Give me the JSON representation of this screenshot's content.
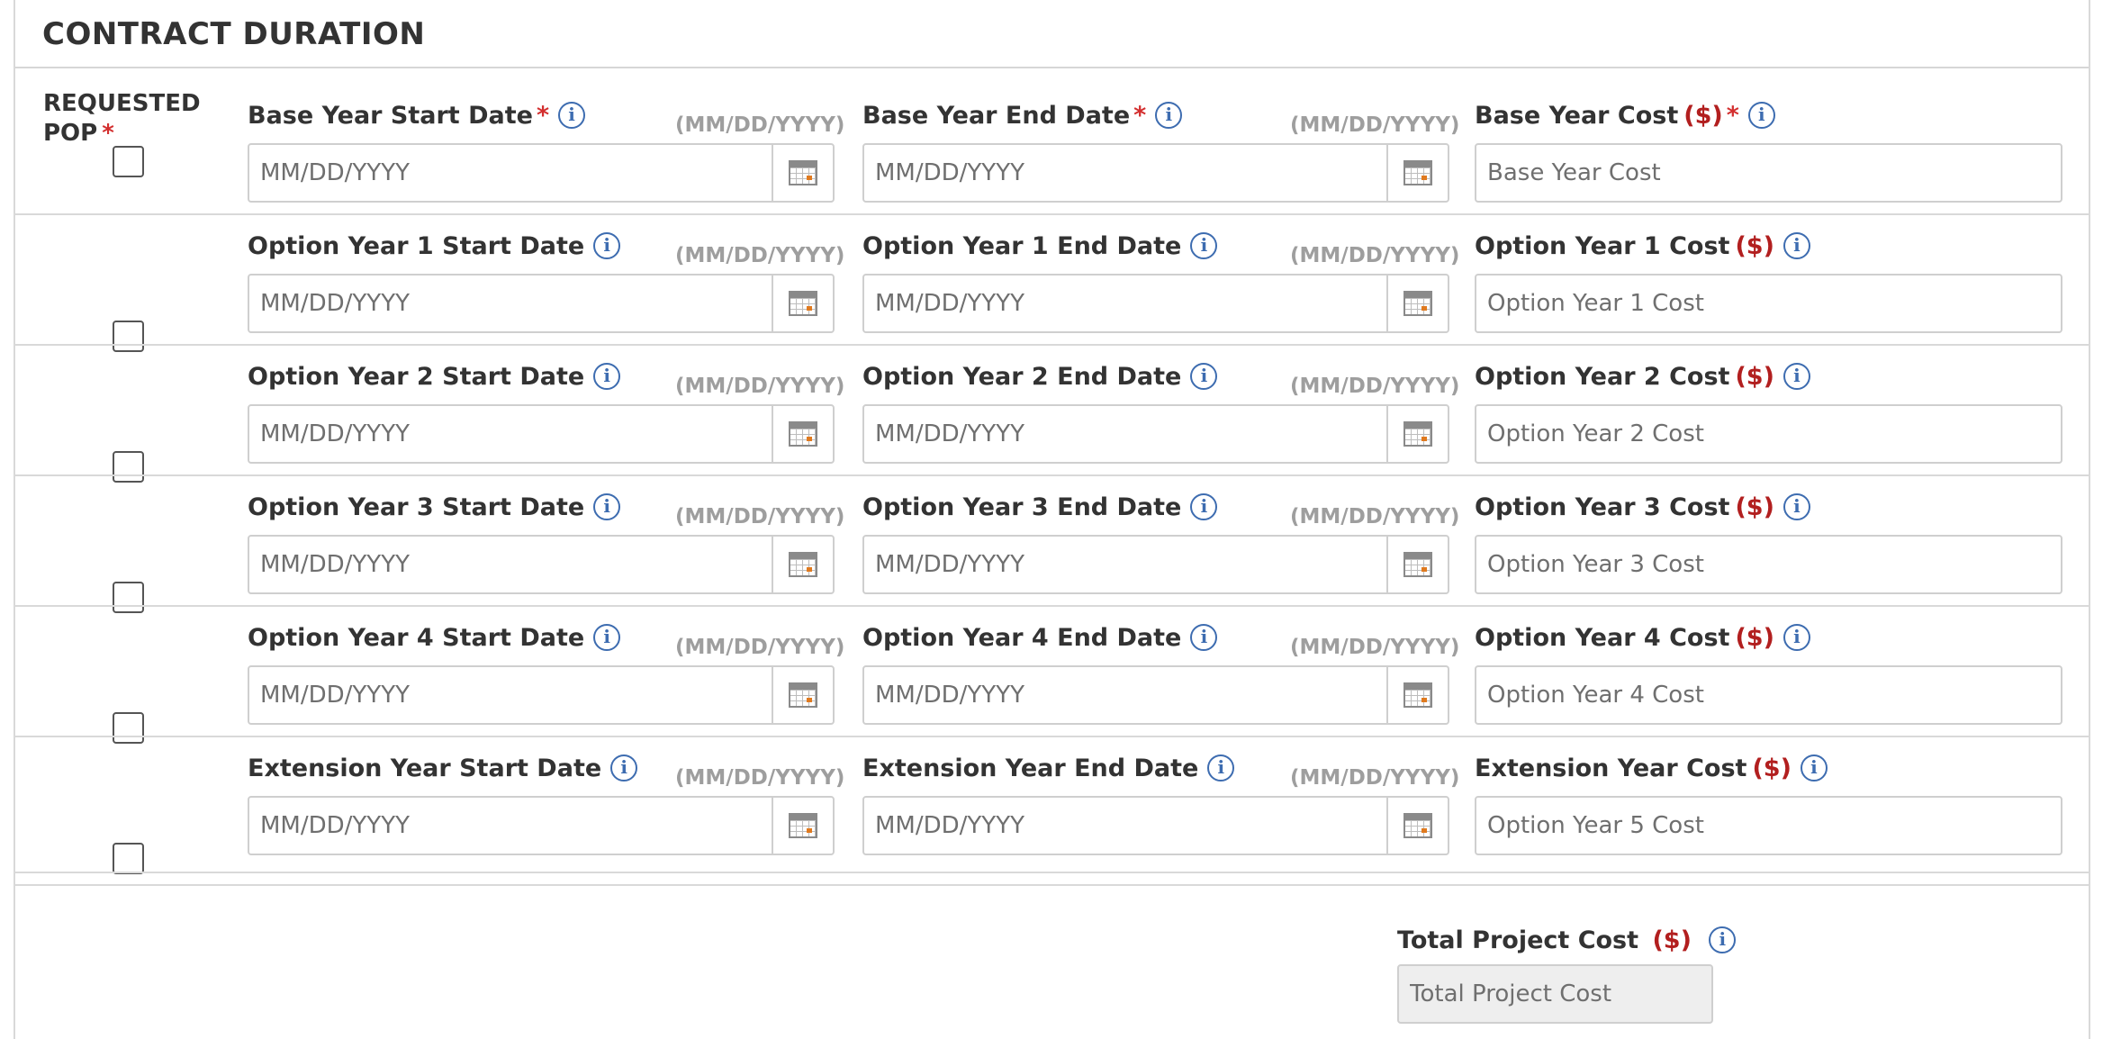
{
  "section": {
    "title": "CONTRACT DURATION"
  },
  "pop": {
    "label_line1": "REQUESTED",
    "label_line2": "POP",
    "required_mark": "*"
  },
  "common": {
    "date_format_hint": "(MM/DD/YYYY)",
    "date_placeholder": "MM/DD/YYYY",
    "currency_suffix": "($)",
    "required_mark": "*",
    "info_glyph": "i"
  },
  "rows": [
    {
      "start_label": "Base Year Start Date",
      "end_label": "Base Year End Date",
      "cost_label": "Base Year Cost",
      "cost_placeholder": "Base Year Cost",
      "required": true,
      "checked": false
    },
    {
      "start_label": "Option Year 1 Start Date",
      "end_label": "Option Year 1 End Date",
      "cost_label": "Option Year 1 Cost",
      "cost_placeholder": "Option Year 1 Cost",
      "required": false,
      "checked": false
    },
    {
      "start_label": "Option Year 2 Start Date",
      "end_label": "Option Year 2 End Date",
      "cost_label": "Option Year 2 Cost",
      "cost_placeholder": "Option Year 2 Cost",
      "required": false,
      "checked": false
    },
    {
      "start_label": "Option Year 3 Start Date",
      "end_label": "Option Year 3 End Date",
      "cost_label": "Option Year 3 Cost",
      "cost_placeholder": "Option Year 3 Cost",
      "required": false,
      "checked": false
    },
    {
      "start_label": "Option Year 4 Start Date",
      "end_label": "Option Year 4 End Date",
      "cost_label": "Option Year 4 Cost",
      "cost_placeholder": "Option Year 4 Cost",
      "required": false,
      "checked": false
    },
    {
      "start_label": "Extension Year Start Date",
      "end_label": "Extension Year End Date",
      "cost_label": "Extension Year Cost",
      "cost_placeholder": "Option Year 5 Cost",
      "required": false,
      "checked": false
    }
  ],
  "total": {
    "label": "Total Project Cost",
    "placeholder": "Total Project Cost"
  },
  "icons": {
    "info": "info-circle-icon",
    "calendar": "calendar-icon"
  },
  "colors": {
    "required": "#d32f2f",
    "currency": "#b21f1f",
    "info": "#3d6cb0",
    "hint": "#9e9e9e",
    "border": "#cfcfcf",
    "calendar_accent": "#e07a1f"
  }
}
